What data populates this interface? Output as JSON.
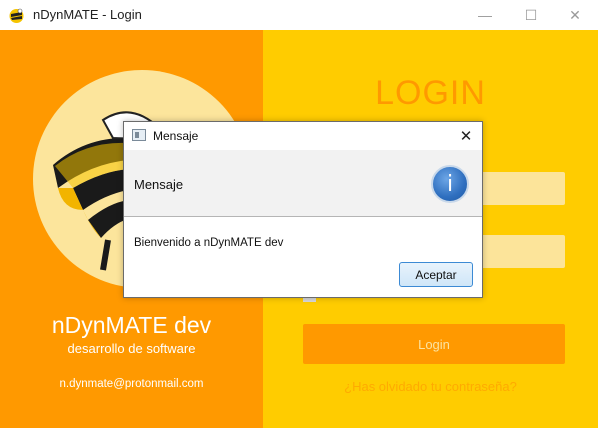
{
  "window": {
    "title": "nDynMATE - Login",
    "controls": {
      "minimize": "—",
      "maximize": "☐",
      "close": "✕"
    }
  },
  "left_panel": {
    "brand_name": "nDynMATE dev",
    "tagline": "desarrollo de software",
    "email": "n.dynmate@protonmail.com",
    "logo_icon": "bee-logo-icon"
  },
  "right_panel": {
    "heading": "LOGIN",
    "login_button": "Login",
    "forgot_link": "¿Has olvidado tu contraseña?"
  },
  "dialog": {
    "title": "Mensaje",
    "close": "✕",
    "header_text": "Mensaje",
    "info_icon_glyph": "i",
    "content": "Bienvenido a nDynMATE dev",
    "ok_button": "Aceptar"
  },
  "colors": {
    "left_bg": "#FF9900",
    "right_bg": "#FFCC00",
    "field_bg": "#FCE49A",
    "accent": "#FF9900"
  }
}
